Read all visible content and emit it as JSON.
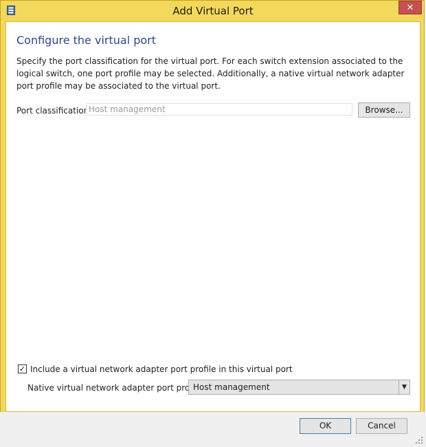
{
  "window": {
    "title": "Add Virtual Port",
    "close_glyph": "✕",
    "icon": "server-icon"
  },
  "main": {
    "heading": "Configure the virtual port",
    "description": "Specify the port classification for the virtual port. For each switch extension associated to the logical switch, one port profile may be selected. Additionally, a native virtual network adapter port profile may be associated to the virtual port.",
    "port_classification": {
      "label": "Port classification:",
      "value": "Host management",
      "browse_label": "Browse..."
    },
    "include_profile": {
      "checked": true,
      "check_glyph": "✓",
      "label": "Include a virtual network adapter port profile in this virtual port"
    },
    "native_profile": {
      "label": "Native virtual network adapter port profile:",
      "selected": "Host management",
      "arrow_glyph": "▼"
    }
  },
  "footer": {
    "ok_label": "OK",
    "cancel_label": "Cancel"
  },
  "colors": {
    "frame": "#f3d95b",
    "heading": "#2a4a8f",
    "close": "#c75050",
    "ok_border": "#3c7fb1"
  }
}
